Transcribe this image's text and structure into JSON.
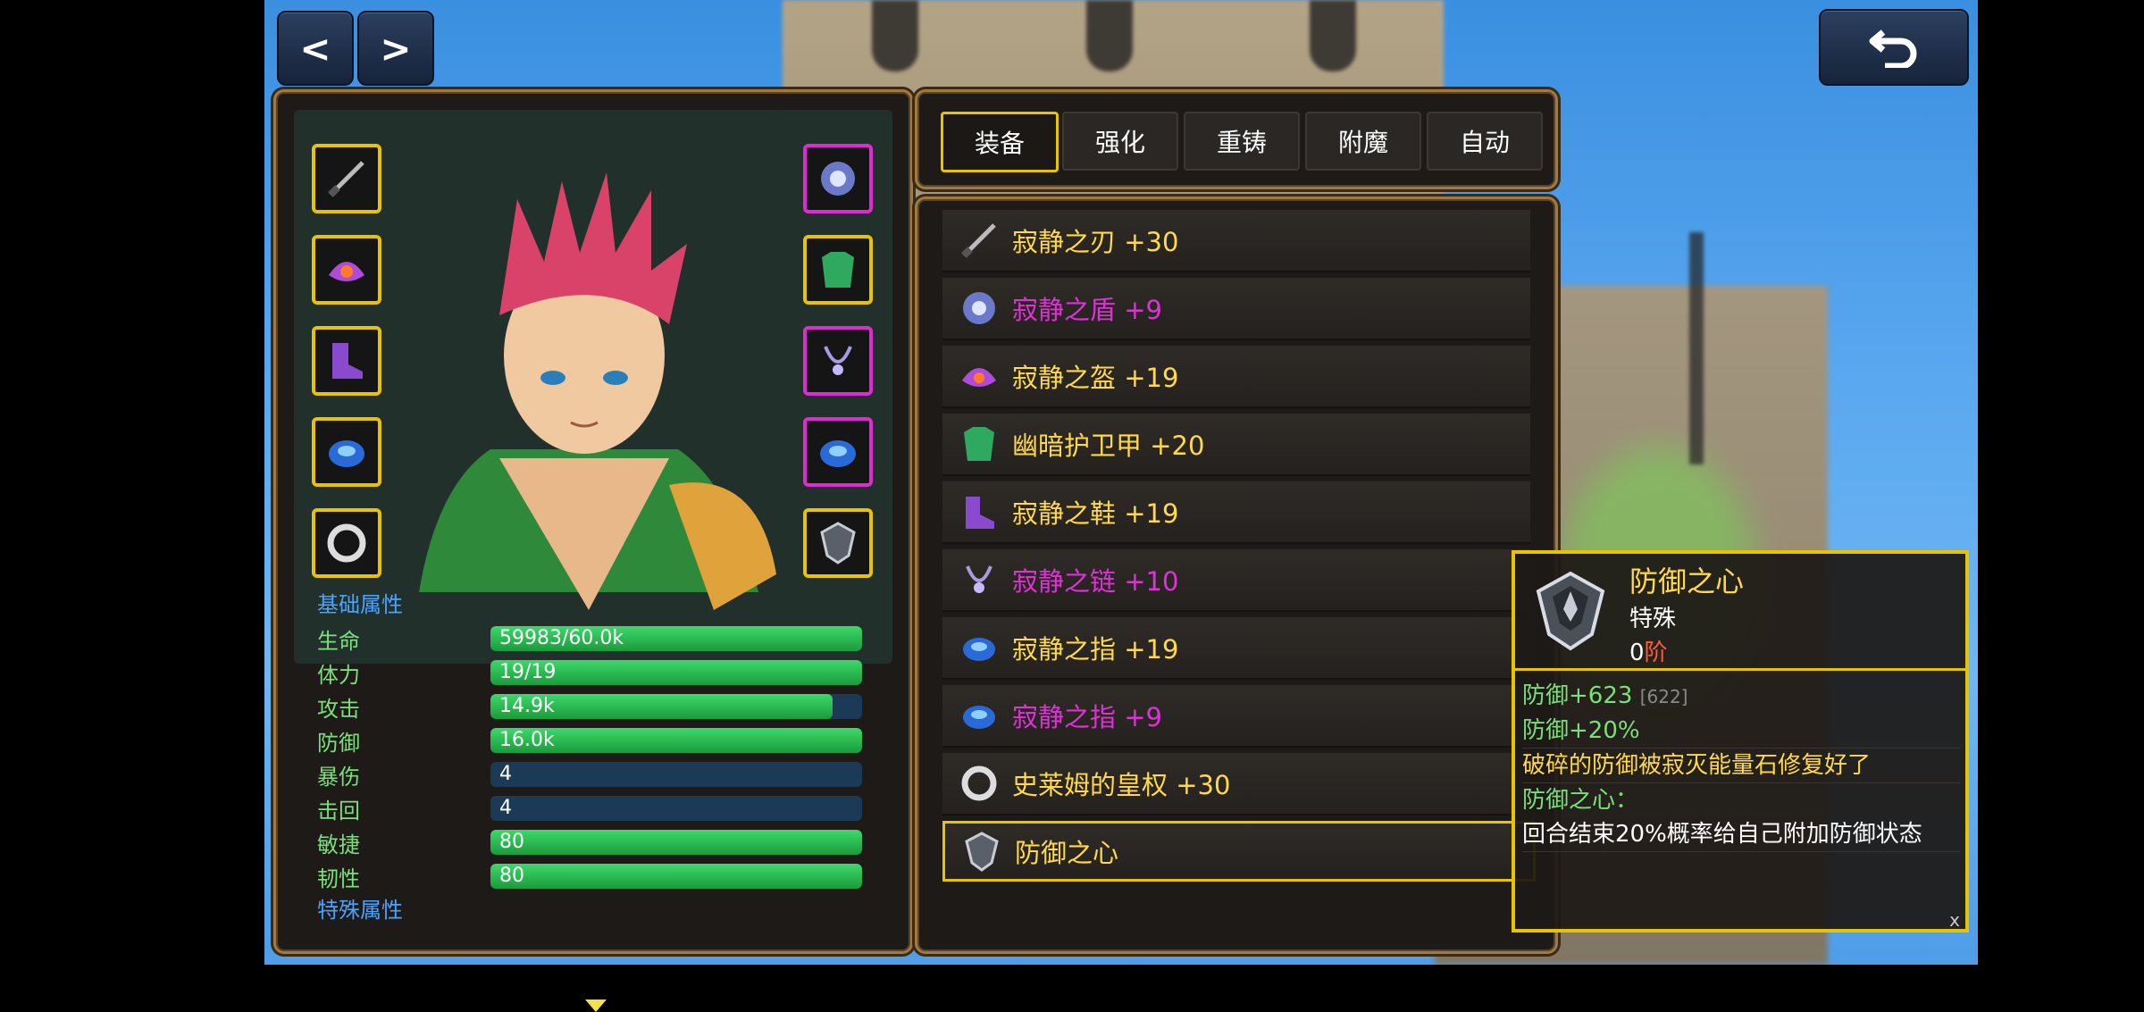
{
  "nav": {
    "prev_label": "<",
    "next_label": ">"
  },
  "tabs": [
    {
      "label": "装备",
      "active": true
    },
    {
      "label": "强化",
      "active": false
    },
    {
      "label": "重铸",
      "active": false
    },
    {
      "label": "附魔",
      "active": false
    },
    {
      "label": "自动",
      "active": false
    }
  ],
  "stats": {
    "base_heading": "基础属性",
    "special_heading": "特殊属性",
    "rows": [
      {
        "label": "生命",
        "value": "59983/60.0k",
        "fill": 1.0
      },
      {
        "label": "体力",
        "value": "19/19",
        "fill": 1.0
      },
      {
        "label": "攻击",
        "value": "14.9k",
        "fill": 0.92
      },
      {
        "label": "防御",
        "value": "16.0k",
        "fill": 1.0
      },
      {
        "label": "暴伤",
        "value": "4",
        "fill": 0.0
      },
      {
        "label": "击回",
        "value": "4",
        "fill": 0.0
      },
      {
        "label": "敏捷",
        "value": "80",
        "fill": 1.0
      },
      {
        "label": "韧性",
        "value": "80",
        "fill": 1.0
      }
    ]
  },
  "equipment": [
    {
      "name": "寂静之刃",
      "level": "+30",
      "rarity": "gold",
      "icon": "sword-icon"
    },
    {
      "name": "寂静之盾",
      "level": "+9",
      "rarity": "magenta",
      "icon": "shield-icon"
    },
    {
      "name": "寂静之盔",
      "level": "+19",
      "rarity": "gold",
      "icon": "helmet-icon"
    },
    {
      "name": "幽暗护卫甲",
      "level": "+20",
      "rarity": "gold",
      "icon": "armor-icon"
    },
    {
      "name": "寂静之鞋",
      "level": "+19",
      "rarity": "gold",
      "icon": "boots-icon"
    },
    {
      "name": "寂静之链",
      "level": "+10",
      "rarity": "magenta",
      "icon": "necklace-icon"
    },
    {
      "name": "寂静之指",
      "level": "+19",
      "rarity": "gold",
      "icon": "ring-icon"
    },
    {
      "name": "寂静之指",
      "level": "+9",
      "rarity": "magenta",
      "icon": "ring-icon"
    },
    {
      "name": "史莱姆的皇权",
      "level": "+30",
      "rarity": "gold",
      "icon": "slime-ring-icon"
    },
    {
      "name": "防御之心",
      "level": "",
      "rarity": "gold",
      "icon": "defense-heart-icon",
      "selected": true
    }
  ],
  "tooltip": {
    "title": "防御之心",
    "type": "特殊",
    "tier_num": "0",
    "tier_word": "阶",
    "stat1_label": "防御",
    "stat1_value": "+623",
    "stat1_extra": "[622]",
    "stat2_label": "防御",
    "stat2_value": "+20%",
    "desc": "破碎的防御被寂灭能量石修复好了",
    "skill_name": "防御之心：",
    "skill_desc": "回合结束20%概率给自己附加防御状态",
    "close": "x"
  },
  "colors": {
    "gold": "#ffd94a",
    "magenta": "#e030d8",
    "slot_gold": "#e8c300",
    "slot_magenta": "#e02ad6",
    "stat_green": "#7be07a",
    "heading_blue": "#4aa3ff"
  }
}
